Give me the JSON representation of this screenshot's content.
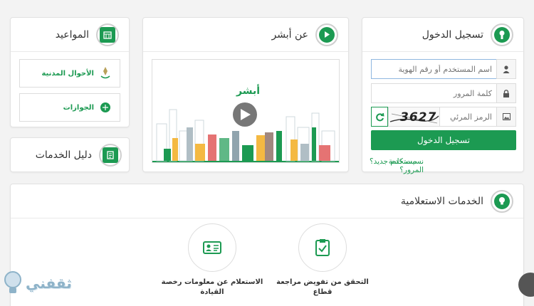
{
  "login": {
    "title": "تسجيل الدخول",
    "username_placeholder": "اسم المستخدم أو رقم الهوية",
    "password_placeholder": "كلمة المرور",
    "captcha_placeholder": "الرمز المرئي",
    "captcha_text": "3627",
    "submit_label": "تسجيل الدخول",
    "new_user_link": "مستخدم جديد؟",
    "forgot_link": "نسيت كلمة المرور؟"
  },
  "about": {
    "title": "عن أبشر",
    "video_logo_text": "أبشر"
  },
  "appointments": {
    "title": "المواعيد",
    "items": [
      {
        "label": "الأحوال المدنية",
        "sub": "الأحوال المدنية"
      },
      {
        "label": "الجوازات"
      }
    ]
  },
  "guide": {
    "title": "دليل الخدمات"
  },
  "inquiry": {
    "title": "الخدمات الاستعلامية",
    "services": [
      {
        "label": "التحقق من تفويض مراجعة قطاع"
      },
      {
        "label": "الاستعلام عن معلومات رخصة القيادة"
      }
    ]
  },
  "watermark": {
    "text": "ثقفني"
  },
  "colors": {
    "accent": "#1c9a52",
    "border": "#e2e2e2",
    "background": "#f3f3f3"
  }
}
